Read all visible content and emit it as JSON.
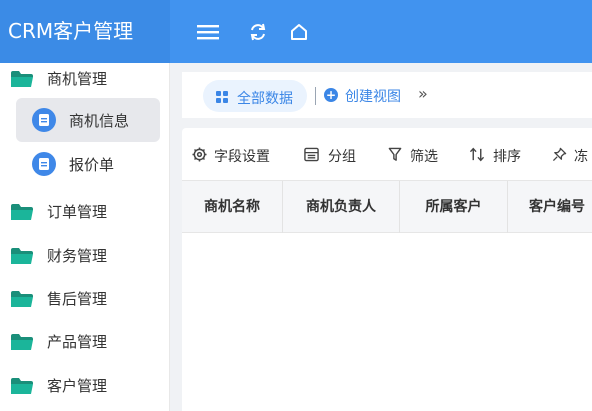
{
  "app": {
    "title": "CRM客户管理"
  },
  "topbar": {
    "icons": [
      "menu-icon",
      "refresh-icon",
      "home-icon"
    ]
  },
  "sidebar": {
    "groups": [
      {
        "label": "商机管理",
        "children": [
          {
            "label": "商机信息",
            "active": true
          },
          {
            "label": "报价单",
            "active": false
          }
        ]
      },
      {
        "label": "订单管理"
      },
      {
        "label": "财务管理"
      },
      {
        "label": "售后管理"
      },
      {
        "label": "产品管理"
      },
      {
        "label": "客户管理"
      }
    ]
  },
  "views": {
    "all_label": "全部数据",
    "create_label": "创建视图",
    "more_glyph": "»"
  },
  "toolbar": {
    "field_settings": "字段设置",
    "group": "分组",
    "filter": "筛选",
    "sort": "排序",
    "freeze": "冻"
  },
  "table": {
    "columns": [
      "商机名称",
      "商机负责人",
      "所属客户",
      "客户编号"
    ],
    "rows": []
  },
  "colors": {
    "brand": "#3b8be6",
    "topbar": "#4193ef",
    "accent": "#3b86e6",
    "folder": "#1bb59a"
  }
}
